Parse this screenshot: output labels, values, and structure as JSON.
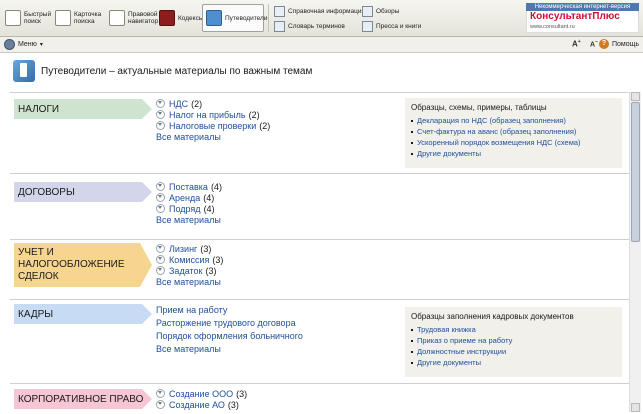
{
  "toolbar": {
    "buttons": [
      {
        "label": "Быстрый\nпоиск"
      },
      {
        "label": "Карточка\nпоиска"
      },
      {
        "label": "Правовой\nнавигатор"
      },
      {
        "label": "Кодексы"
      },
      {
        "label": "Путеводители"
      }
    ],
    "small": [
      {
        "label": "Справочная информация"
      },
      {
        "label": "Словарь терминов"
      },
      {
        "label": "Обзоры"
      },
      {
        "label": "Пресса и книги"
      }
    ]
  },
  "brand": {
    "top": "Некоммерческая интернет-версия",
    "name": "КонсультантПлюс",
    "url": "www.consultant.ru"
  },
  "bar2": {
    "menu": "Меню",
    "font_up": "A",
    "font_down": "A",
    "help": "Помощь"
  },
  "page": {
    "title": "Путеводители – актуальные материалы по важным темам"
  },
  "colors": {
    "nalogi": "#cfe4cf",
    "dogovory": "#d3d6ea",
    "uchet": "#f6d58e",
    "kadry": "#c7dcf4",
    "korp": "#f6c6d4"
  },
  "sections": [
    {
      "category": "НАЛОГИ",
      "links": [
        {
          "text": "НДС",
          "count": "(2)"
        },
        {
          "text": "Налог на прибыль",
          "count": "(2)"
        },
        {
          "text": "Налоговые проверки",
          "count": "(2)"
        }
      ],
      "all": "Все материалы",
      "box": {
        "title": "Образцы, схемы, примеры, таблицы",
        "items": [
          "Декларация по НДС (образец заполнения)",
          "Счет-фактура на аванс (образец заполнения)",
          "Ускоренный порядок возмещения НДС (схема)",
          "Другие документы"
        ]
      }
    },
    {
      "category": "ДОГОВОРЫ",
      "links": [
        {
          "text": "Поставка",
          "count": "(4)"
        },
        {
          "text": "Аренда",
          "count": "(4)"
        },
        {
          "text": "Подряд",
          "count": "(4)"
        }
      ],
      "all": "Все материалы"
    },
    {
      "category": "УЧЕТ И НАЛОГООБЛОЖЕНИЕ СДЕЛОК",
      "links": [
        {
          "text": "Лизинг",
          "count": "(3)"
        },
        {
          "text": "Комиссия",
          "count": "(3)"
        },
        {
          "text": "Задаток",
          "count": "(3)"
        }
      ],
      "all": "Все материалы"
    },
    {
      "category": "КАДРЫ",
      "plain_links": [
        "Прием на работу",
        "Расторжение трудового договора",
        "Порядок оформления больничного"
      ],
      "all": "Все материалы",
      "box": {
        "title": "Образцы заполнения кадровых документов",
        "items": [
          "Трудовая книжка",
          "Приказ о приеме на работу",
          "Должностные инструкции",
          "Другие документы"
        ]
      }
    },
    {
      "category": "КОРПОРАТИВНОЕ ПРАВО",
      "links": [
        {
          "text": "Создание ООО",
          "count": "(3)"
        },
        {
          "text": "Создание АО",
          "count": "(3)"
        }
      ]
    }
  ]
}
